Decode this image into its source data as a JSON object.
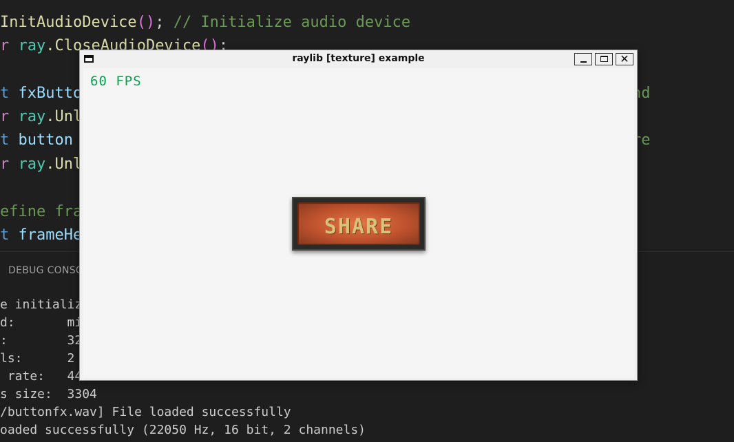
{
  "editor": {
    "line1": {
      "fn": "InitAudioDevice",
      "paren": "()",
      "semi": ";",
      "comment": "// Initialize audio device"
    },
    "line2": {
      "kw": "r",
      "ns": "ray",
      "fn": ".CloseAudioDevice",
      "paren": "()",
      "semi": ";"
    },
    "line3": {
      "type": "t",
      "var": "fxButto",
      "right": "nd"
    },
    "line4": {
      "kw": "r",
      "ns": "ray",
      "fn": ".Unl"
    },
    "line5": {
      "type": "t",
      "var": "button",
      "right": "re"
    },
    "line6": {
      "kw": "r",
      "ns": "ray",
      "fn": ".Unl"
    },
    "line7": {
      "kw": "efine",
      "var": "fra"
    },
    "line8": {
      "type": "t",
      "var": "frameHe"
    }
  },
  "panel": {
    "tab_label": "DEBUG CONSC",
    "lines": [
      "e initializ",
      "d:       mi",
      ":        32",
      "ls:      2",
      " rate:   44",
      "s size:  3304",
      "/buttonfx.wav] File loaded successfully",
      "oaded successfully (22050 Hz, 16 bit, 2 channels)"
    ]
  },
  "window": {
    "title": "raylib [texture] example",
    "minimize_label": "_",
    "close_label": "✕",
    "fps_text": "60 FPS",
    "button_label": "SHARE"
  },
  "icons": {
    "app": "window-icon",
    "minimize": "minimize-icon",
    "maximize": "maximize-icon",
    "close": "close-icon"
  }
}
